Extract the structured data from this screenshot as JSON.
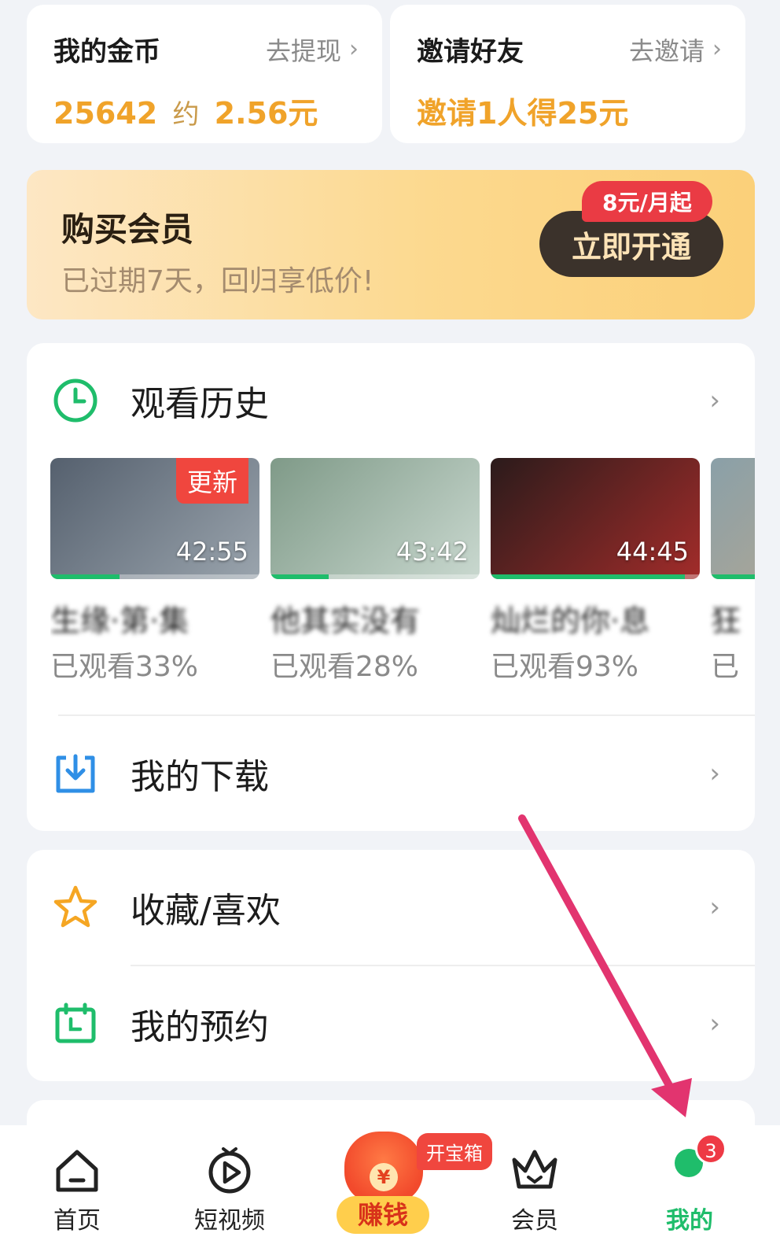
{
  "coins": {
    "title": "我的金币",
    "action": "去提现",
    "amount": "25642",
    "approx_word": "约",
    "cash": "2.56元"
  },
  "invite": {
    "title": "邀请好友",
    "action": "去邀请",
    "reward": "邀请1人得25元"
  },
  "vip": {
    "title": "购买会员",
    "subtitle": "已过期7天，回归享低价!",
    "badge": "8元/月起",
    "button": "立即开通"
  },
  "history": {
    "title": "观看历史",
    "items": [
      {
        "name": "生缘·第·集",
        "duration": "42:55",
        "tag": "更新",
        "progress_label": "已观看33%",
        "progress": 0.33,
        "colors": [
          "#55606e",
          "#9aa4ad"
        ]
      },
      {
        "name": "他其实没有",
        "duration": "43:42",
        "progress_label": "已观看28%",
        "progress": 0.28,
        "colors": [
          "#7f9a88",
          "#c9d8cf"
        ]
      },
      {
        "name": "灿烂的你·息",
        "duration": "44:45",
        "progress_label": "已观看93%",
        "progress": 0.93,
        "colors": [
          "#2b1b1b",
          "#a22c2a"
        ]
      },
      {
        "name": "狂",
        "duration": "",
        "progress_label": "已",
        "progress": 1.0,
        "colors": [
          "#8aa0a8",
          "#c0a98c"
        ]
      }
    ]
  },
  "downloads": {
    "label": "我的下载"
  },
  "favorites": {
    "label": "收藏/喜欢"
  },
  "reservations": {
    "label": "我的预约"
  },
  "tabs": {
    "home": "首页",
    "short_video": "短视频",
    "earn": "赚钱",
    "treasure": "开宝箱",
    "member": "会员",
    "mine": "我的",
    "mine_badge": "3"
  },
  "colors": {
    "accent": "#1fbd6b",
    "gold": "#f0a32a",
    "red": "#ee3a45",
    "arrow": "#e2346f"
  }
}
